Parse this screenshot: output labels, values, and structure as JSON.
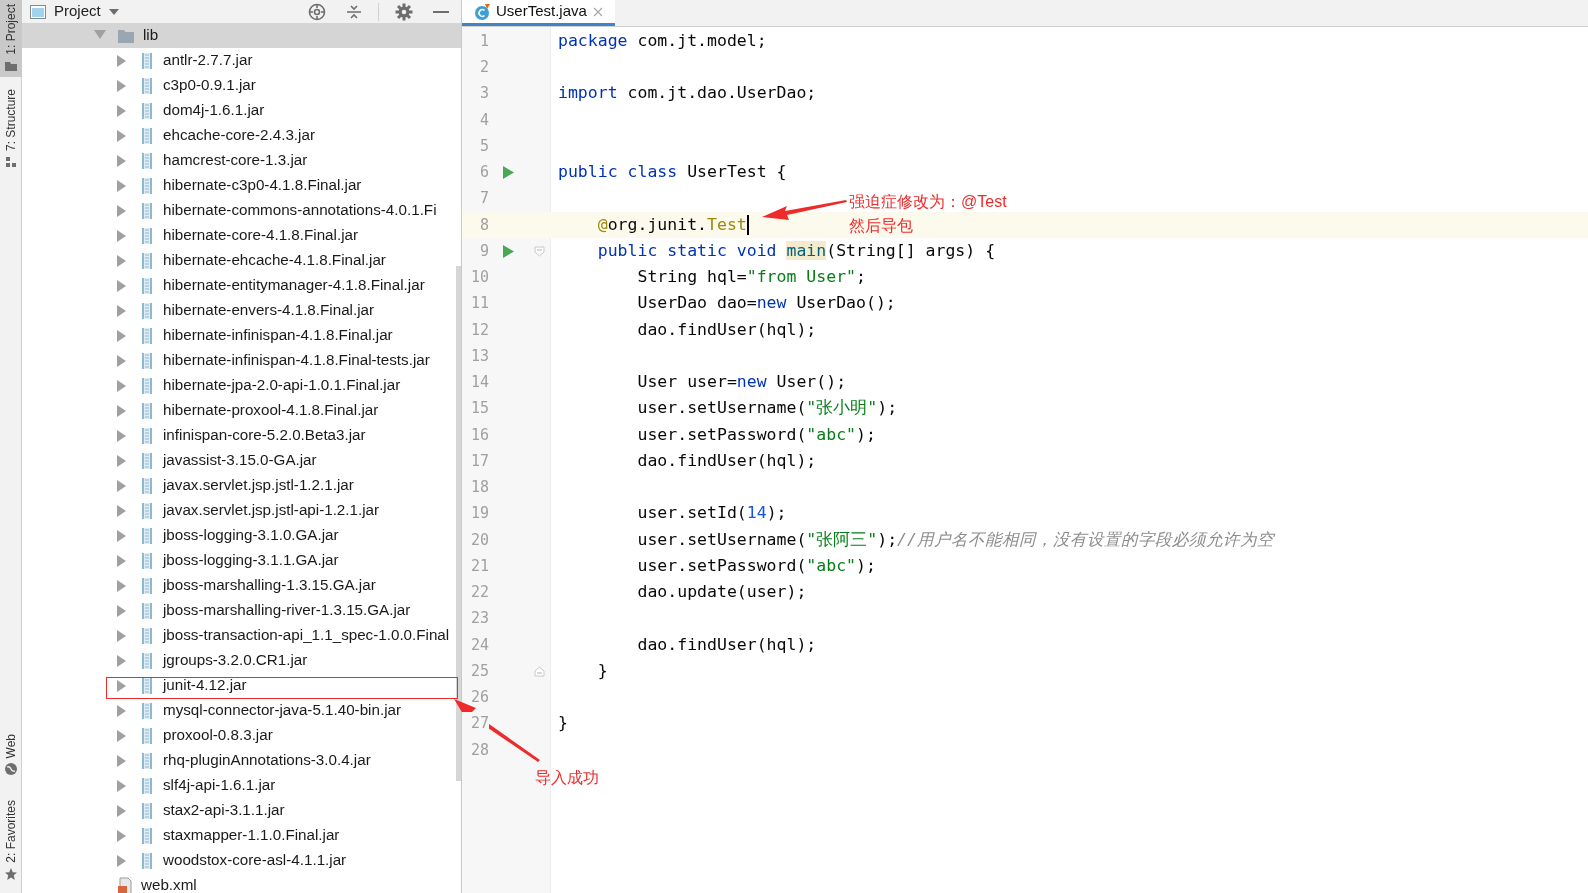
{
  "tool_strip": {
    "top": [
      {
        "label": "1: Project",
        "selected": true,
        "kind": "folder"
      },
      {
        "label": "7: Structure",
        "selected": false,
        "kind": "structure"
      }
    ],
    "bottom": [
      {
        "label": "Web",
        "selected": false,
        "kind": "globe"
      },
      {
        "label": "2: Favorites",
        "selected": false,
        "kind": "star"
      }
    ]
  },
  "project_panel": {
    "title": "Project",
    "tree": [
      {
        "label": "lib",
        "kind": "folder",
        "expanded": true,
        "selected": true,
        "children": [
          {
            "label": "antlr-2.7.7.jar",
            "kind": "jar",
            "expanded": false,
            "selected": false
          },
          {
            "label": "c3p0-0.9.1.jar",
            "kind": "jar",
            "expanded": false,
            "selected": false
          },
          {
            "label": "dom4j-1.6.1.jar",
            "kind": "jar",
            "expanded": false,
            "selected": false
          },
          {
            "label": "ehcache-core-2.4.3.jar",
            "kind": "jar",
            "expanded": false,
            "selected": false
          },
          {
            "label": "hamcrest-core-1.3.jar",
            "kind": "jar",
            "expanded": false,
            "selected": false
          },
          {
            "label": "hibernate-c3p0-4.1.8.Final.jar",
            "kind": "jar",
            "expanded": false,
            "selected": false
          },
          {
            "label": "hibernate-commons-annotations-4.0.1.Fi",
            "kind": "jar",
            "expanded": false,
            "selected": false
          },
          {
            "label": "hibernate-core-4.1.8.Final.jar",
            "kind": "jar",
            "expanded": false,
            "selected": false
          },
          {
            "label": "hibernate-ehcache-4.1.8.Final.jar",
            "kind": "jar",
            "expanded": false,
            "selected": false
          },
          {
            "label": "hibernate-entitymanager-4.1.8.Final.jar",
            "kind": "jar",
            "expanded": false,
            "selected": false
          },
          {
            "label": "hibernate-envers-4.1.8.Final.jar",
            "kind": "jar",
            "expanded": false,
            "selected": false
          },
          {
            "label": "hibernate-infinispan-4.1.8.Final.jar",
            "kind": "jar",
            "expanded": false,
            "selected": false
          },
          {
            "label": "hibernate-infinispan-4.1.8.Final-tests.jar",
            "kind": "jar",
            "expanded": false,
            "selected": false
          },
          {
            "label": "hibernate-jpa-2.0-api-1.0.1.Final.jar",
            "kind": "jar",
            "expanded": false,
            "selected": false
          },
          {
            "label": "hibernate-proxool-4.1.8.Final.jar",
            "kind": "jar",
            "expanded": false,
            "selected": false
          },
          {
            "label": "infinispan-core-5.2.0.Beta3.jar",
            "kind": "jar",
            "expanded": false,
            "selected": false
          },
          {
            "label": "javassist-3.15.0-GA.jar",
            "kind": "jar",
            "expanded": false,
            "selected": false
          },
          {
            "label": "javax.servlet.jsp.jstl-1.2.1.jar",
            "kind": "jar",
            "expanded": false,
            "selected": false
          },
          {
            "label": "javax.servlet.jsp.jstl-api-1.2.1.jar",
            "kind": "jar",
            "expanded": false,
            "selected": false
          },
          {
            "label": "jboss-logging-3.1.0.GA.jar",
            "kind": "jar",
            "expanded": false,
            "selected": false
          },
          {
            "label": "jboss-logging-3.1.1.GA.jar",
            "kind": "jar",
            "expanded": false,
            "selected": false
          },
          {
            "label": "jboss-marshalling-1.3.15.GA.jar",
            "kind": "jar",
            "expanded": false,
            "selected": false
          },
          {
            "label": "jboss-marshalling-river-1.3.15.GA.jar",
            "kind": "jar",
            "expanded": false,
            "selected": false
          },
          {
            "label": "jboss-transaction-api_1.1_spec-1.0.0.Final",
            "kind": "jar",
            "expanded": false,
            "selected": false
          },
          {
            "label": "jgroups-3.2.0.CR1.jar",
            "kind": "jar",
            "expanded": false,
            "selected": false
          },
          {
            "label": "junit-4.12.jar",
            "kind": "jar",
            "expanded": false,
            "selected": false
          },
          {
            "label": "mysql-connector-java-5.1.40-bin.jar",
            "kind": "jar",
            "expanded": false,
            "selected": false
          },
          {
            "label": "proxool-0.8.3.jar",
            "kind": "jar",
            "expanded": false,
            "selected": false
          },
          {
            "label": "rhq-pluginAnnotations-3.0.4.jar",
            "kind": "jar",
            "expanded": false,
            "selected": false
          },
          {
            "label": "slf4j-api-1.6.1.jar",
            "kind": "jar",
            "expanded": false,
            "selected": false
          },
          {
            "label": "stax2-api-3.1.1.jar",
            "kind": "jar",
            "expanded": false,
            "selected": false
          },
          {
            "label": "staxmapper-1.1.0.Final.jar",
            "kind": "jar",
            "expanded": false,
            "selected": false
          },
          {
            "label": "woodstox-core-asl-4.1.1.jar",
            "kind": "jar",
            "expanded": false,
            "selected": false
          }
        ]
      },
      {
        "label": "web.xml",
        "kind": "xml",
        "selected": false
      }
    ]
  },
  "editor": {
    "tabs": [
      {
        "label": "UserTest.java",
        "selected": true
      }
    ],
    "lines": [
      {
        "number": "1",
        "run": false,
        "current": false,
        "segments": [
          {
            "kind": "keyword",
            "text": "package"
          },
          {
            "kind": "plain",
            "text": " com.jt.model;"
          }
        ]
      },
      {
        "number": "2",
        "run": false,
        "current": false
      },
      {
        "number": "3",
        "run": false,
        "current": false,
        "segments": [
          {
            "kind": "keyword",
            "text": "import"
          },
          {
            "kind": "plain",
            "text": " com.jt.dao.UserDao;"
          }
        ]
      },
      {
        "number": "4",
        "run": false,
        "current": false
      },
      {
        "number": "5",
        "run": false,
        "current": false
      },
      {
        "number": "6",
        "run": true,
        "current": false,
        "segments": [
          {
            "kind": "keyword",
            "text": "public class"
          },
          {
            "kind": "plain",
            "text": " UserTest {"
          }
        ]
      },
      {
        "number": "7",
        "run": false,
        "current": false
      },
      {
        "number": "8",
        "run": false,
        "current": true,
        "segments": [
          {
            "kind": "annotation",
            "text": "    @"
          },
          {
            "kind": "plain",
            "text": "org.junit."
          },
          {
            "kind": "annotation",
            "text": "Test"
          }
        ]
      },
      {
        "number": "9",
        "run": true,
        "current": false,
        "fold": {
          "kind": "start"
        },
        "segments": [
          {
            "kind": "keyword",
            "text": "    public static void "
          },
          {
            "kind": "declaration",
            "text": "main"
          },
          {
            "kind": "plain",
            "text": "(String[] args) {"
          }
        ]
      },
      {
        "number": "10",
        "run": false,
        "current": false,
        "segments": [
          {
            "kind": "plain",
            "text": "        String hql="
          },
          {
            "kind": "string",
            "text": "\"from User\""
          },
          {
            "kind": "plain",
            "text": ";"
          }
        ]
      },
      {
        "number": "11",
        "run": false,
        "current": false,
        "segments": [
          {
            "kind": "plain",
            "text": "        UserDao dao="
          },
          {
            "kind": "keyword",
            "text": "new"
          },
          {
            "kind": "plain",
            "text": " UserDao();"
          }
        ]
      },
      {
        "number": "12",
        "run": false,
        "current": false,
        "segments": [
          {
            "kind": "plain",
            "text": "        dao.findUser(hql);"
          }
        ]
      },
      {
        "number": "13",
        "run": false,
        "current": false
      },
      {
        "number": "14",
        "run": false,
        "current": false,
        "segments": [
          {
            "kind": "plain",
            "text": "        User user="
          },
          {
            "kind": "keyword",
            "text": "new"
          },
          {
            "kind": "plain",
            "text": " User();"
          }
        ]
      },
      {
        "number": "15",
        "run": false,
        "current": false,
        "segments": [
          {
            "kind": "plain",
            "text": "        user.setUsername("
          },
          {
            "kind": "string",
            "text": "\"张小明\""
          },
          {
            "kind": "plain",
            "text": ");"
          }
        ]
      },
      {
        "number": "16",
        "run": false,
        "current": false,
        "segments": [
          {
            "kind": "plain",
            "text": "        user.setPassword("
          },
          {
            "kind": "string",
            "text": "\"abc\""
          },
          {
            "kind": "plain",
            "text": ");"
          }
        ]
      },
      {
        "number": "17",
        "run": false,
        "current": false,
        "segments": [
          {
            "kind": "plain",
            "text": "        dao.findUser(hql);"
          }
        ]
      },
      {
        "number": "18",
        "run": false,
        "current": false
      },
      {
        "number": "19",
        "run": false,
        "current": false,
        "segments": [
          {
            "kind": "plain",
            "text": "        user.setId("
          },
          {
            "kind": "number",
            "text": "14"
          },
          {
            "kind": "plain",
            "text": ");"
          }
        ]
      },
      {
        "number": "20",
        "run": false,
        "current": false,
        "segments": [
          {
            "kind": "plain",
            "text": "        user.setUsername("
          },
          {
            "kind": "string",
            "text": "\"张阿三\""
          },
          {
            "kind": "plain",
            "text": ");"
          },
          {
            "kind": "comment",
            "text": "//用户名不能相同，没有设置的字段必须允许为空"
          }
        ]
      },
      {
        "number": "21",
        "run": false,
        "current": false,
        "segments": [
          {
            "kind": "plain",
            "text": "        user.setPassword("
          },
          {
            "kind": "string",
            "text": "\"abc\""
          },
          {
            "kind": "plain",
            "text": ");"
          }
        ]
      },
      {
        "number": "22",
        "run": false,
        "current": false,
        "segments": [
          {
            "kind": "plain",
            "text": "        dao.update(user);"
          }
        ]
      },
      {
        "number": "23",
        "run": false,
        "current": false
      },
      {
        "number": "24",
        "run": false,
        "current": false,
        "segments": [
          {
            "kind": "plain",
            "text": "        dao.findUser(hql);"
          }
        ]
      },
      {
        "number": "25",
        "run": false,
        "current": false,
        "fold": {
          "kind": "end"
        },
        "segments": [
          {
            "kind": "plain",
            "text": "    }"
          }
        ]
      },
      {
        "number": "26",
        "run": false,
        "current": false
      },
      {
        "number": "27",
        "run": false,
        "current": false,
        "segments": [
          {
            "kind": "plain",
            "text": "}"
          }
        ]
      },
      {
        "number": "28",
        "run": false,
        "current": false
      }
    ]
  },
  "annotations": [
    {
      "kind": "note",
      "lines": [
        "强迫症修改为：@Test",
        "然后导包"
      ]
    },
    {
      "kind": "note",
      "lines": [
        "导入成功"
      ]
    }
  ]
}
